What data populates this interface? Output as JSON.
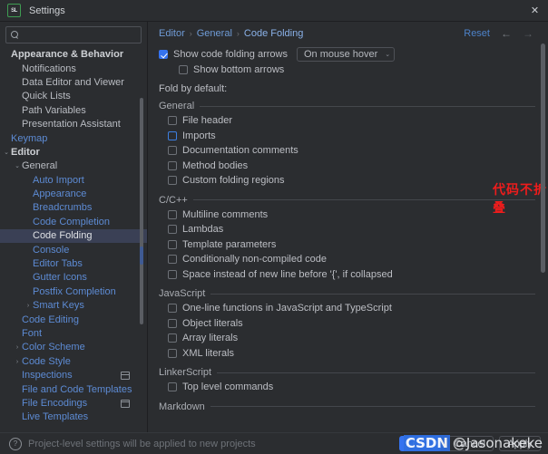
{
  "window": {
    "title": "Settings",
    "icon": "sql-app-icon",
    "close_label": "✕"
  },
  "sidebar": {
    "search": {
      "placeholder": "",
      "value": "",
      "icon": "search-icon"
    },
    "items": [
      {
        "label": "Appearance & Behavior",
        "level": 0,
        "style": "head",
        "arrow": ""
      },
      {
        "label": "Notifications",
        "level": 1,
        "style": "norm",
        "arrow": ""
      },
      {
        "label": "Data Editor and Viewer",
        "level": 1,
        "style": "norm",
        "arrow": ""
      },
      {
        "label": "Quick Lists",
        "level": 1,
        "style": "norm",
        "arrow": ""
      },
      {
        "label": "Path Variables",
        "level": 1,
        "style": "norm",
        "arrow": ""
      },
      {
        "label": "Presentation Assistant",
        "level": 1,
        "style": "norm",
        "arrow": ""
      },
      {
        "label": "Keymap",
        "level": 0,
        "style": "blue",
        "arrow": ""
      },
      {
        "label": "Editor",
        "level": 0,
        "style": "head",
        "arrow": "⌄"
      },
      {
        "label": "General",
        "level": 1,
        "style": "norm",
        "arrow": "⌄"
      },
      {
        "label": "Auto Import",
        "level": 2,
        "style": "blue",
        "arrow": ""
      },
      {
        "label": "Appearance",
        "level": 2,
        "style": "blue",
        "arrow": ""
      },
      {
        "label": "Breadcrumbs",
        "level": 2,
        "style": "blue",
        "arrow": ""
      },
      {
        "label": "Code Completion",
        "level": 2,
        "style": "blue",
        "arrow": ""
      },
      {
        "label": "Code Folding",
        "level": 2,
        "style": "blue",
        "arrow": "",
        "selected": true
      },
      {
        "label": "Console",
        "level": 2,
        "style": "blue",
        "arrow": ""
      },
      {
        "label": "Editor Tabs",
        "level": 2,
        "style": "blue",
        "arrow": ""
      },
      {
        "label": "Gutter Icons",
        "level": 2,
        "style": "blue",
        "arrow": ""
      },
      {
        "label": "Postfix Completion",
        "level": 2,
        "style": "blue",
        "arrow": ""
      },
      {
        "label": "Smart Keys",
        "level": 2,
        "style": "blue",
        "arrow": "›"
      },
      {
        "label": "Code Editing",
        "level": 1,
        "style": "blue",
        "arrow": ""
      },
      {
        "label": "Font",
        "level": 1,
        "style": "blue",
        "arrow": ""
      },
      {
        "label": "Color Scheme",
        "level": 1,
        "style": "blue",
        "arrow": "›"
      },
      {
        "label": "Code Style",
        "level": 1,
        "style": "blue",
        "arrow": "›"
      },
      {
        "label": "Inspections",
        "level": 1,
        "style": "blue",
        "arrow": "",
        "badge": true
      },
      {
        "label": "File and Code Templates",
        "level": 1,
        "style": "blue",
        "arrow": ""
      },
      {
        "label": "File Encodings",
        "level": 1,
        "style": "blue",
        "arrow": "",
        "badge": true
      },
      {
        "label": "Live Templates",
        "level": 1,
        "style": "blue",
        "arrow": ""
      }
    ]
  },
  "breadcrumbs": {
    "items": [
      "Editor",
      "General",
      "Code Folding"
    ],
    "separator": "›",
    "reset_label": "Reset",
    "back_arrow": "←",
    "forward_arrow": "→"
  },
  "main": {
    "show_arrows": {
      "label": "Show code folding arrows",
      "checked": true,
      "dropdown_value": "On mouse hover",
      "dropdown_arrow": "⌄"
    },
    "show_bottom_arrows": {
      "label": "Show bottom arrows",
      "checked": false
    },
    "fold_by_default_label": "Fold by default:",
    "annotation": "代码不折叠",
    "groups": [
      {
        "title": "General",
        "items": [
          {
            "label": "File header",
            "checked": false
          },
          {
            "label": "Imports",
            "checked": false,
            "focused": true
          },
          {
            "label": "Documentation comments",
            "checked": false
          },
          {
            "label": "Method bodies",
            "checked": false
          },
          {
            "label": "Custom folding regions",
            "checked": false
          }
        ]
      },
      {
        "title": "C/C++",
        "items": [
          {
            "label": "Multiline comments",
            "checked": false
          },
          {
            "label": "Lambdas",
            "checked": false
          },
          {
            "label": "Template parameters",
            "checked": false
          },
          {
            "label": "Conditionally non-compiled code",
            "checked": false
          },
          {
            "label": "Space instead of new line before '{', if collapsed",
            "checked": false
          }
        ]
      },
      {
        "title": "JavaScript",
        "items": [
          {
            "label": "One-line functions in JavaScript and TypeScript",
            "checked": false
          },
          {
            "label": "Object literals",
            "checked": false
          },
          {
            "label": "Array literals",
            "checked": false
          },
          {
            "label": "XML literals",
            "checked": false
          }
        ]
      },
      {
        "title": "LinkerScript",
        "items": [
          {
            "label": "Top level commands",
            "checked": false
          }
        ]
      },
      {
        "title": "Markdown",
        "items": []
      }
    ]
  },
  "footer": {
    "help_icon": "?",
    "note": "Project-level settings will be applied to new projects",
    "buttons": [
      {
        "label": "OK",
        "primary": true
      },
      {
        "label": "Cancel",
        "primary": false
      },
      {
        "label": "Apply",
        "primary": false
      }
    ]
  },
  "watermark": {
    "brand": "CSDN",
    "user": "@Jasonakeke"
  },
  "colors": {
    "background": "#2b2d30",
    "selection": "#3a4055",
    "accent": "#3573f0",
    "link": "#5d8bd4",
    "annotation": "#ee1c1c",
    "text": "#bcbec4"
  }
}
